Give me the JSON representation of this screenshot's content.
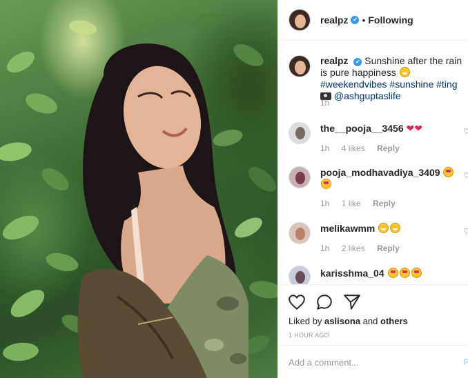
{
  "post": {
    "username": "realpz",
    "verified_mark": "✔",
    "separator": "•",
    "follow_status": "Following"
  },
  "caption": {
    "username": "realpz",
    "text_1": "Sunshine after the rain is pure happiness",
    "hashtag_1": "#weekendvibes",
    "hashtag_2": "#sunshine",
    "hashtag_3": "#ting",
    "mention": "@ashguptaslife",
    "time": "1h"
  },
  "comments": [
    {
      "username": "the__pooja__3456",
      "time": "1h",
      "likes": "4 likes",
      "reply": "Reply"
    },
    {
      "username": "pooja_modhavadiya_3409",
      "time": "1h",
      "likes": "1 like",
      "reply": "Reply"
    },
    {
      "username": "melikawmm",
      "time": "1h",
      "likes": "2 likes",
      "reply": "Reply"
    },
    {
      "username": "karisshma_04"
    }
  ],
  "actions": {
    "liked_by_prefix": "Liked by",
    "liked_by_user": "aslisona",
    "liked_by_and": "and",
    "liked_by_others": "others",
    "time_ago": "1 HOUR AGO"
  },
  "add_comment": {
    "placeholder": "Add a comment...",
    "post_label": "P"
  },
  "icons": {
    "like": "heart-icon",
    "comment": "comment-icon",
    "share": "share-icon"
  },
  "colors": {
    "verified": "#3897f0",
    "link": "#003569",
    "meta": "#999999",
    "heart": "#e0245e"
  }
}
